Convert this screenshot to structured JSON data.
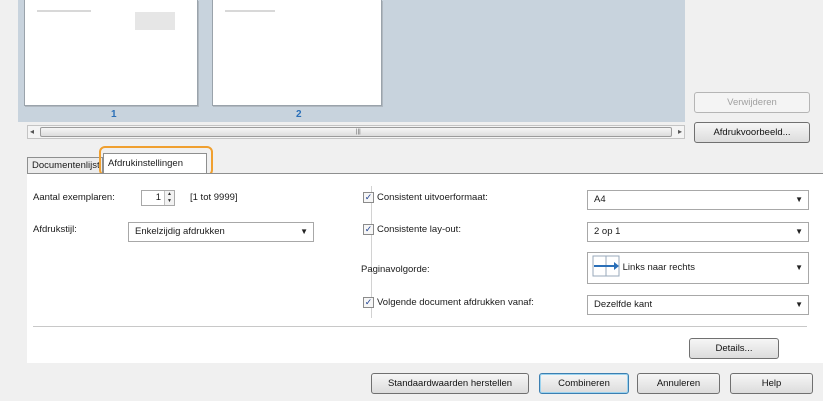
{
  "preview": {
    "page_numbers": [
      "1",
      "2"
    ]
  },
  "side_buttons": {
    "remove": "Verwijderen",
    "print_preview": "Afdrukvoorbeeld..."
  },
  "tabs": [
    {
      "label": "Documentenlijst"
    },
    {
      "label": "Afdrukinstellingen"
    }
  ],
  "left": {
    "copies_label": "Aantal exemplaren:",
    "copies_value": "1",
    "copies_range": "[1 tot 9999]",
    "print_style_label": "Afdrukstijl:",
    "print_style_value": "Enkelzijdig afdrukken"
  },
  "right": {
    "consistent_format_label": "Consistent uitvoerformaat:",
    "consistent_format_checked": true,
    "consistent_format_value": "A4",
    "consistent_layout_label": "Consistente lay-out:",
    "consistent_layout_checked": true,
    "consistent_layout_value": "2 op 1",
    "page_order_label": "Paginavolgorde:",
    "page_order_value": "Links naar rechts",
    "next_doc_label": "Volgende document afdrukken vanaf:",
    "next_doc_checked": true,
    "next_doc_value": "Dezelfde kant"
  },
  "details_button": "Details...",
  "footer": {
    "restore_defaults": "Standaardwaarden herstellen",
    "combine": "Combineren",
    "cancel": "Annuleren",
    "help": "Help"
  },
  "colors": {
    "highlight": "#f0a030",
    "page_number": "#2a6fb8",
    "preview_bg": "#c8d3dd"
  }
}
